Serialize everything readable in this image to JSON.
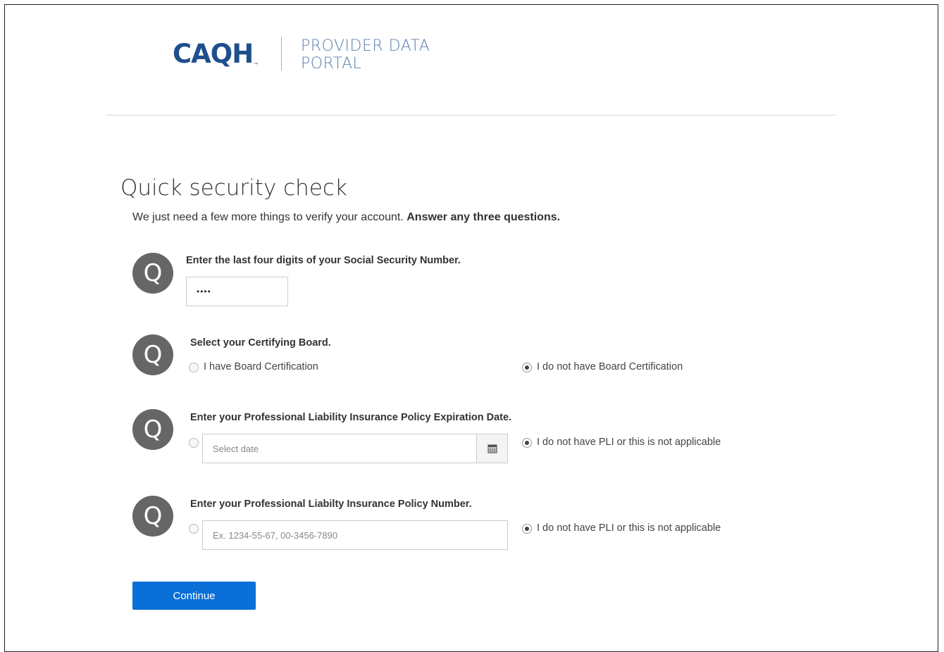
{
  "header": {
    "logo_text": "CAQH",
    "logo_tm": "™",
    "portal_line1": "PROVIDER DATA",
    "portal_line2": "PORTAL"
  },
  "page": {
    "title": "Quick security check",
    "subtitle_plain": "We just need a few more things to verify your account.",
    "subtitle_bold": "Answer any three questions."
  },
  "questions": [
    {
      "badge": "Q",
      "text": "Enter the last four digits of your Social Security Number.",
      "value": "••••"
    },
    {
      "badge": "Q",
      "text": "Select your Certifying Board.",
      "option_a": "I have Board Certification",
      "option_b": "I do not have Board Certification",
      "selected": "option_b"
    },
    {
      "badge": "Q",
      "text": "Enter your Professional Liability Insurance Policy Expiration Date.",
      "placeholder": "Select date",
      "option_b": "I do not have PLI or this is not applicable",
      "selected": "option_b"
    },
    {
      "badge": "Q",
      "text": "Enter your Professional Liabilty Insurance Policy Number.",
      "placeholder": "Ex. 1234-55-67, 00-3456-7890",
      "option_b": "I do not have PLI or this is not applicable",
      "selected": "option_b"
    }
  ],
  "actions": {
    "continue_label": "Continue"
  },
  "colors": {
    "brand": "#1f4e8c",
    "primary_button": "#0a6fd6",
    "badge": "#666666"
  }
}
